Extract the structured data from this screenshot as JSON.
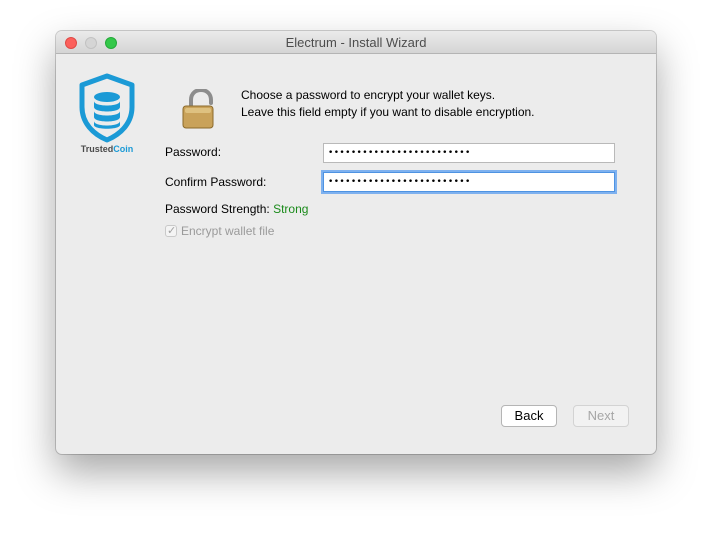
{
  "window": {
    "title": "Electrum  -  Install Wizard"
  },
  "logo": {
    "text_part1": "Trusted",
    "text_part2": "Coin",
    "accent_color": "#1b9ad6"
  },
  "instructions": {
    "line1": "Choose a password to encrypt your wallet keys.",
    "line2": "Leave this field empty if you want to disable encryption."
  },
  "form": {
    "password_label": "Password:",
    "password_value": "•••••••••••••••••••••••••",
    "confirm_label": "Confirm Password:",
    "confirm_value": "•••••••••••••••••••••••••",
    "strength_label": "Password Strength:",
    "strength_value": "Strong",
    "strength_color": "#1a8a1a",
    "encrypt_label": "Encrypt wallet file",
    "encrypt_checked": true
  },
  "buttons": {
    "back": "Back",
    "next": "Next"
  }
}
